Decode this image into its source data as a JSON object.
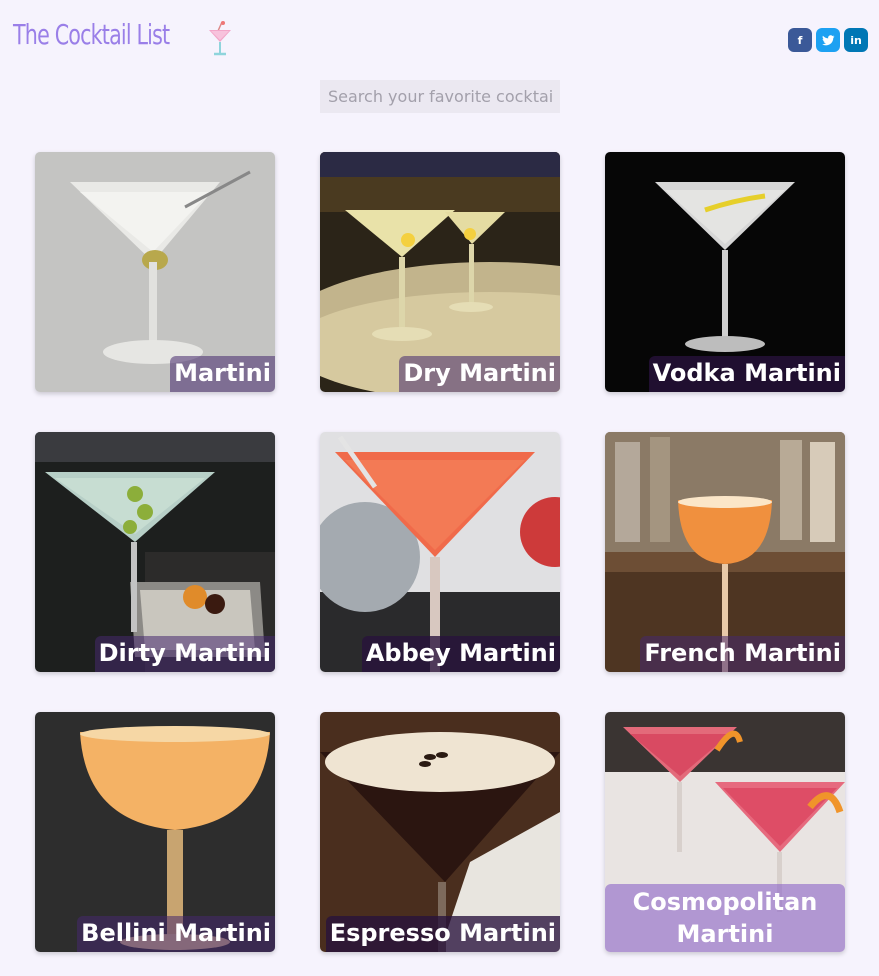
{
  "header": {
    "title": "The Cocktail List",
    "logo_icon": "martini-glass-icon",
    "social": [
      {
        "icon": "facebook-icon",
        "glyph": "f",
        "color": "#3b5998"
      },
      {
        "icon": "twitter-icon",
        "glyph": "t",
        "color": "#1da1f2"
      },
      {
        "icon": "linkedin-icon",
        "glyph": "in",
        "color": "#0077b5"
      }
    ]
  },
  "search": {
    "placeholder": "Search your favorite cocktail",
    "value": ""
  },
  "cocktails": [
    {
      "name": "Martini"
    },
    {
      "name": "Dry Martini"
    },
    {
      "name": "Vodka Martini"
    },
    {
      "name": "Dirty Martini"
    },
    {
      "name": "Abbey Martini"
    },
    {
      "name": "French Martini"
    },
    {
      "name": "Bellini Martini"
    },
    {
      "name": "Espresso Martini"
    },
    {
      "name": "Cosmopolitan Martini"
    }
  ],
  "colors": {
    "brand": "#9a7fe8",
    "background": "#f6f3fd",
    "label_overlay": "#46286e"
  }
}
